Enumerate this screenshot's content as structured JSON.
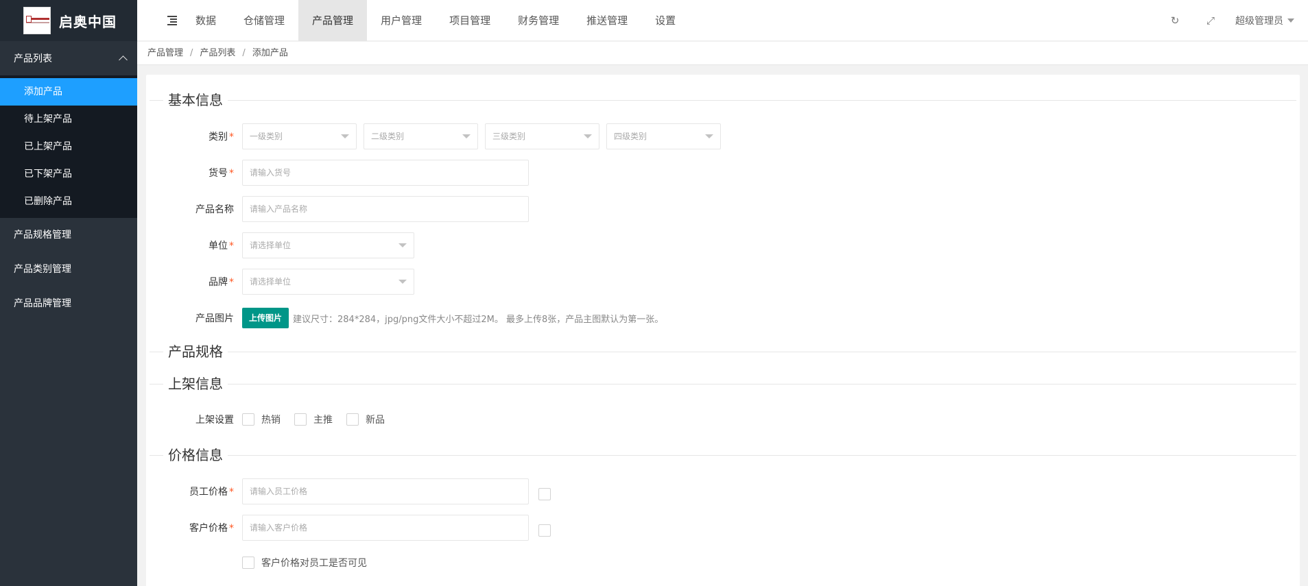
{
  "app": {
    "logo_text": "启奥中国"
  },
  "sidebar": {
    "group": {
      "label": "产品列表"
    },
    "sub_items": [
      {
        "label": "添加产品"
      },
      {
        "label": "待上架产品"
      },
      {
        "label": "已上架产品"
      },
      {
        "label": "已下架产品"
      },
      {
        "label": "已删除产品"
      }
    ],
    "items": [
      {
        "label": "产品规格管理"
      },
      {
        "label": "产品类别管理"
      },
      {
        "label": "产品品牌管理"
      }
    ]
  },
  "header": {
    "tabs": [
      {
        "label": "数据"
      },
      {
        "label": "仓储管理"
      },
      {
        "label": "产品管理"
      },
      {
        "label": "用户管理"
      },
      {
        "label": "项目管理"
      },
      {
        "label": "财务管理"
      },
      {
        "label": "推送管理"
      },
      {
        "label": "设置"
      }
    ],
    "refresh_icon": "↻",
    "fullscreen_icon": "⤢",
    "user": "超级管理员"
  },
  "breadcrumb": [
    "产品管理",
    "产品列表",
    "添加产品"
  ],
  "form": {
    "sections": {
      "basic": "基本信息",
      "spec": "产品规格",
      "listing": "上架信息",
      "price": "价格信息"
    },
    "category": {
      "label": "类别",
      "selects": [
        "一级类别",
        "二级类别",
        "三级类别",
        "四级类别"
      ]
    },
    "sku": {
      "label": "货号",
      "placeholder": "请输入货号"
    },
    "name": {
      "label": "产品名称",
      "placeholder": "请输入产品名称"
    },
    "unit": {
      "label": "单位",
      "placeholder": "请选择单位"
    },
    "brand": {
      "label": "品牌",
      "placeholder": "请选择单位"
    },
    "image": {
      "label": "产品图片",
      "button": "上传图片",
      "hint": "建议尺寸：284*284，jpg/png文件大小不超过2M。 最多上传8张，产品主图默认为第一张。"
    },
    "listing_settings": {
      "label": "上架设置",
      "options": [
        "热销",
        "主推",
        "新品"
      ]
    },
    "staff_price": {
      "label": "员工价格",
      "placeholder": "请输入员工价格"
    },
    "customer_price": {
      "label": "客户价格",
      "placeholder": "请输入客户价格"
    },
    "visibility": {
      "label": "客户价格对员工是否可见"
    }
  },
  "colors": {
    "accent": "#1e9fff",
    "upload": "#009688",
    "required": "#ff5722"
  }
}
